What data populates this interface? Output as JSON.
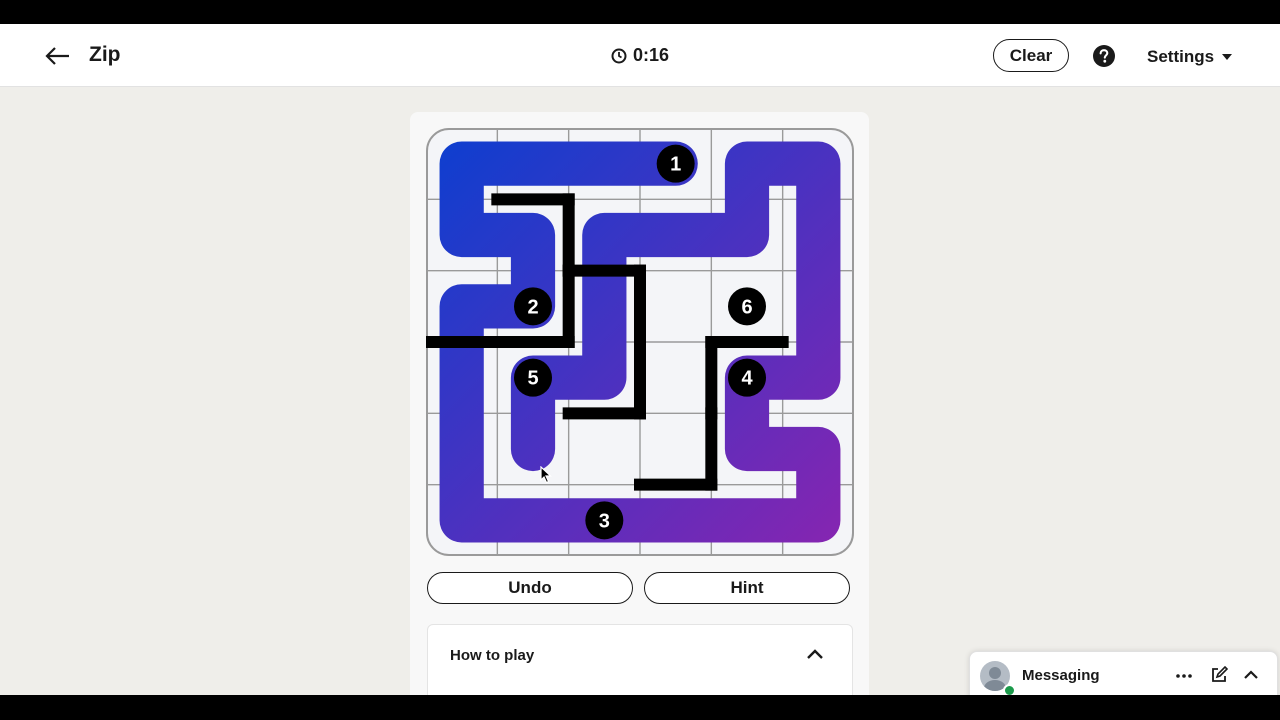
{
  "header": {
    "back_icon": "arrow-left-icon",
    "title": "Zip",
    "timer": "0:16",
    "timer_icon": "clock-icon",
    "clear_label": "Clear",
    "help_icon": "question-circle-icon",
    "settings_label": "Settings",
    "settings_icon": "caret-down-icon"
  },
  "puzzle": {
    "grid_size": 6,
    "waypoints": [
      {
        "label": "1",
        "row": 0,
        "col": 3
      },
      {
        "label": "2",
        "row": 2,
        "col": 1
      },
      {
        "label": "3",
        "row": 5,
        "col": 2
      },
      {
        "label": "4",
        "row": 3,
        "col": 4
      },
      {
        "label": "5",
        "row": 3,
        "col": 1
      },
      {
        "label": "6",
        "row": 2,
        "col": 4
      }
    ],
    "drawn_path": [
      [
        0,
        3
      ],
      [
        0,
        2
      ],
      [
        0,
        1
      ],
      [
        0,
        0
      ],
      [
        1,
        0
      ],
      [
        1,
        1
      ],
      [
        2,
        1
      ],
      [
        2,
        0
      ],
      [
        3,
        0
      ],
      [
        4,
        0
      ],
      [
        5,
        0
      ],
      [
        5,
        1
      ],
      [
        5,
        2
      ],
      [
        5,
        3
      ],
      [
        5,
        4
      ],
      [
        5,
        5
      ],
      [
        4,
        5
      ],
      [
        4,
        4
      ],
      [
        3,
        4
      ],
      [
        3,
        5
      ],
      [
        2,
        5
      ],
      [
        1,
        5
      ],
      [
        0,
        5
      ],
      [
        0,
        4
      ],
      [
        1,
        4
      ],
      [
        1,
        3
      ],
      [
        1,
        2
      ],
      [
        2,
        2
      ],
      [
        3,
        2
      ],
      [
        3,
        1
      ],
      [
        4,
        1
      ]
    ],
    "walls": [
      {
        "cell": [
          1,
          1
        ],
        "side": "top"
      },
      {
        "cell": [
          1,
          1
        ],
        "side": "right"
      },
      {
        "cell": [
          2,
          1
        ],
        "side": "right"
      },
      {
        "cell": [
          2,
          1
        ],
        "side": "bottom"
      },
      {
        "cell": [
          2,
          0
        ],
        "side": "bottom"
      },
      {
        "cell": [
          2,
          2
        ],
        "side": "top"
      },
      {
        "cell": [
          2,
          3
        ],
        "side": "left"
      },
      {
        "cell": [
          3,
          3
        ],
        "side": "left"
      },
      {
        "cell": [
          3,
          2
        ],
        "side": "bottom"
      },
      {
        "cell": [
          3,
          4
        ],
        "side": "top"
      },
      {
        "cell": [
          3,
          4
        ],
        "side": "left"
      },
      {
        "cell": [
          4,
          4
        ],
        "side": "left"
      },
      {
        "cell": [
          4,
          3
        ],
        "side": "bottom"
      }
    ],
    "path_color_start": "#0a3fd0",
    "path_color_end": "#8a24b0"
  },
  "controls": {
    "undo_label": "Undo",
    "hint_label": "Hint"
  },
  "how_to_play": {
    "title": "How to play",
    "toggle_icon": "chevron-up-icon"
  },
  "messaging": {
    "title": "Messaging",
    "more_icon": "ellipsis-icon",
    "compose_icon": "compose-icon",
    "collapse_icon": "chevron-up-icon"
  }
}
